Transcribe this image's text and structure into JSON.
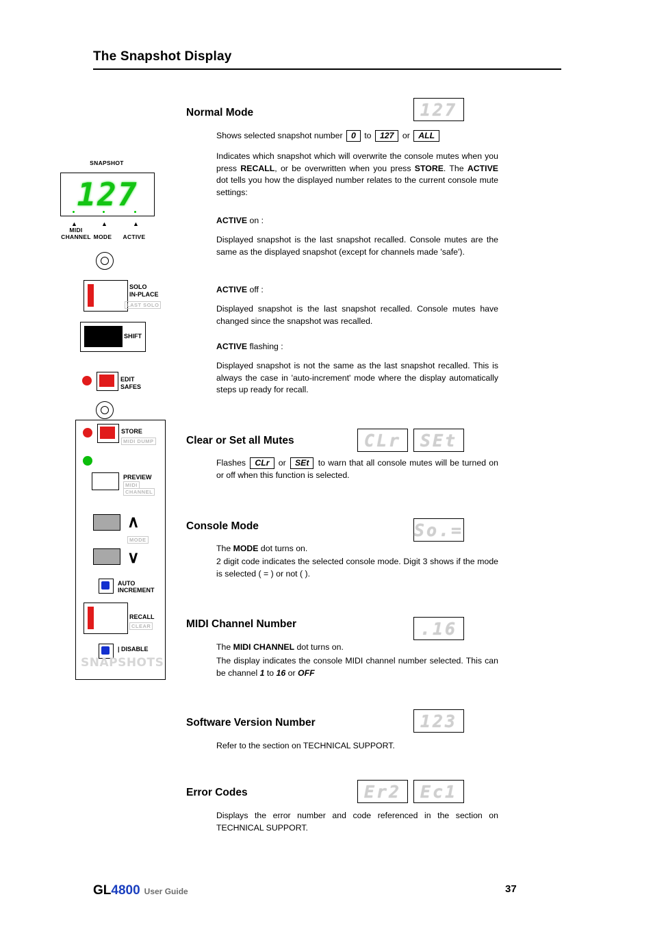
{
  "header": {
    "title": "The Snapshot Display"
  },
  "displays": {
    "normal_mode": "127",
    "clear_mutes": "CLr",
    "set_mutes": "SEt",
    "console_mode": "So.=",
    "midi_channel": ".16",
    "software_version": "123",
    "error_1": "Er2",
    "error_2": "Ec1",
    "panel_main": "127"
  },
  "sections": {
    "normal_mode": {
      "title": "Normal Mode",
      "line1_pre": "Shows selected snapshot number",
      "val_min": "0",
      "to": "to",
      "val_max": "127",
      "or": "or",
      "val_all": "ALL",
      "p1_a": "Indicates which snapshot which will overwrite the console mutes when you press ",
      "p1_b": "RECALL",
      "p1_c": ", or be overwritten when you press ",
      "p1_d": "STORE",
      "p1_e": ". The ",
      "p1_f": "ACTIVE",
      "p1_g": " dot tells you how the displayed number relates to the current console mute settings:",
      "active_on_head": "ACTIVE",
      "active_on_suffix": " on :",
      "active_on_body": "Displayed snapshot is the last snapshot recalled. Console mutes are the same as the displayed snapshot (except for channels made 'safe').",
      "active_off_head": "ACTIVE",
      "active_off_suffix": " off :",
      "active_off_body": "Displayed snapshot is the last snapshot recalled. Console mutes have changed since the snapshot was recalled.",
      "active_flash_head": "ACTIVE",
      "active_flash_suffix": " flashing :",
      "active_flash_body": "Displayed snapshot is not the same as the last snapshot recalled.  This is always the case in 'auto-increment' mode where the display automatically steps up ready for recall."
    },
    "clear_set": {
      "title": "Clear or Set all Mutes",
      "p_a": "Flashes",
      "v1": "CLr",
      "or": "or",
      "v2": "SEt",
      "p_b": "to warn that all console mutes will be turned on or off when this function is selected."
    },
    "console_mode": {
      "title": "Console Mode",
      "p_a": "The ",
      "p_b": "MODE",
      "p_c": " dot turns on.",
      "p2": "2 digit code indicates the selected console mode.  Digit 3 shows if the mode is selected ( = ) or not (  )."
    },
    "midi_channel": {
      "title": "MIDI Channel Number",
      "p_a": "The  ",
      "p_b": "MIDI CHANNEL",
      "p_c": " dot turns on.",
      "p2_a": " The display indicates the console MIDI channel number selected.  This can be channel",
      "v1": "1",
      "to": "to",
      "v2": "16",
      "or": "or",
      "v3": "OFF"
    },
    "software_version": {
      "title": "Software Version Number",
      "body": "Refer to the section on TECHNICAL SUPPORT."
    },
    "error_codes": {
      "title": "Error Codes",
      "body": "Displays the error number and code referenced in the section on TECHNICAL SUPPORT."
    }
  },
  "panel": {
    "snapshot_label": "SNAPSHOT",
    "midi_channel_label_1": "MIDI",
    "midi_channel_label_2": "CHANNEL",
    "mode_label": "MODE",
    "active_label": "ACTIVE",
    "solo_line1": "SOLO",
    "solo_line2": "IN-PLACE",
    "solo_sub": "LAST SOLO",
    "shift_label": "SHIFT",
    "edit_line1": "EDIT",
    "edit_line2": "SAFES",
    "store_label": "STORE",
    "store_sub": "MIDI DUMP",
    "preview_label": "PREVIEW",
    "preview_sub1": "MIDI",
    "preview_sub2": "CHANNEL",
    "up_glyph": "∧",
    "down_glyph": "∨",
    "mode_sub": "MODE",
    "auto_line1": "AUTO",
    "auto_line2": "INCREMENT",
    "recall_label": "RECALL",
    "recall_sub": "CLEAR",
    "disable_label": "| DISABLE",
    "snapshots_word": "SNAPSHOTS"
  },
  "footer": {
    "brand_gl": "GL",
    "brand_num": "4800",
    "user_guide": "User Guide",
    "page_number": "37"
  }
}
